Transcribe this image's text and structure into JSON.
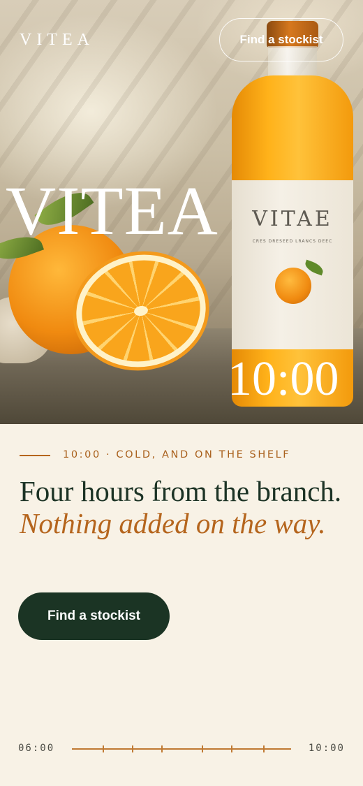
{
  "header": {
    "brand": "VITEA",
    "cta_label": "Find a stockist"
  },
  "hero": {
    "wordmark": "VITEA",
    "time": "10:00",
    "bottle_label": {
      "brand": "VITAE",
      "subtitle": "CRES DRESEED LRANCS DEEC"
    }
  },
  "main": {
    "eyebrow": "10:00 · COLD, AND ON THE SHELF",
    "headline_plain": "Four hours from the branch. ",
    "headline_accent": "Nothing added on the way.",
    "cta_label": "Find a stockist"
  },
  "timeline": {
    "start": "06:00",
    "end": "10:00",
    "tick_count": 7
  },
  "colors": {
    "background": "#f8f2e6",
    "accent": "#b5651d",
    "primary": "#1b3424",
    "headline": "#1c3325"
  }
}
